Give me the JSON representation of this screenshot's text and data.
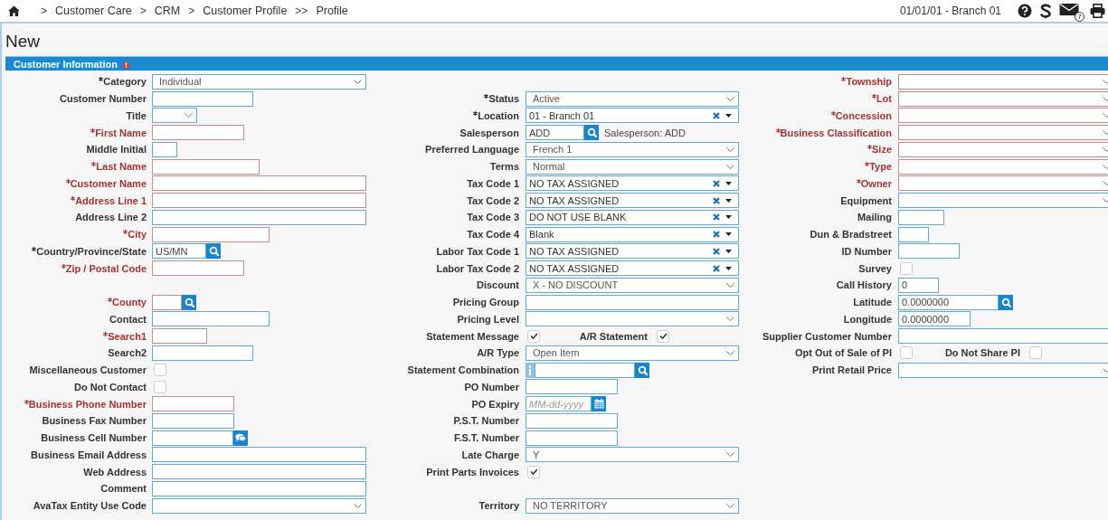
{
  "breadcrumb": [
    {
      "kind": "separator",
      "text": ">"
    },
    {
      "kind": "link",
      "text": "Customer Care"
    },
    {
      "kind": "separator",
      "text": ">"
    },
    {
      "kind": "link",
      "text": "CRM"
    },
    {
      "kind": "separator",
      "text": ">"
    },
    {
      "kind": "link",
      "text": "Customer Profile"
    },
    {
      "kind": "separator",
      "text": ">>"
    },
    {
      "kind": "current",
      "text": "Profile"
    }
  ],
  "session": "01/01/01 - Branch 01",
  "mail_count": "7",
  "page_title": "New",
  "section": {
    "title": "Customer Information",
    "warning": true
  },
  "columns": [
    {
      "groups": [
        [
          {
            "label": "Category",
            "kind": "select",
            "required": true,
            "invalid": false,
            "value": "Individual"
          },
          {
            "label": "Customer Number",
            "kind": "text",
            "required": false,
            "invalid": false
          },
          {
            "label": "Title",
            "kind": "select",
            "required": false,
            "invalid": false
          },
          {
            "label": "First Name",
            "kind": "text",
            "required": true,
            "invalid": true
          },
          {
            "label": "Middle Initial",
            "kind": "text",
            "required": false,
            "invalid": false
          },
          {
            "label": "Last Name",
            "kind": "text",
            "required": true,
            "invalid": true
          },
          {
            "label": "Customer Name",
            "kind": "text",
            "required": true,
            "invalid": true
          },
          {
            "label": "Address Line 1",
            "kind": "text",
            "required": true,
            "invalid": true
          },
          {
            "label": "Address Line 2",
            "kind": "text",
            "required": false,
            "invalid": false
          },
          {
            "label": "City",
            "kind": "text",
            "required": true,
            "invalid": true
          },
          {
            "label": "Country/Province/State",
            "kind": "lookup",
            "required": true,
            "invalid": false,
            "value": "US/MN"
          },
          {
            "label": "Zip / Postal Code",
            "kind": "text",
            "required": true,
            "invalid": true
          }
        ],
        [
          {
            "label": "County",
            "kind": "lookup",
            "required": true,
            "invalid": true
          },
          {
            "label": "Contact",
            "kind": "text",
            "required": false,
            "invalid": false
          },
          {
            "label": "Search1",
            "kind": "text",
            "required": true,
            "invalid": true
          },
          {
            "label": "Search2",
            "kind": "text",
            "required": false,
            "invalid": false
          },
          {
            "label": "Miscellaneous Customer",
            "kind": "checkbox",
            "required": false,
            "invalid": false,
            "checked": false
          },
          {
            "label": "Do Not Contact",
            "kind": "checkbox",
            "required": false,
            "invalid": false,
            "checked": false
          },
          {
            "label": "Business Phone Number",
            "kind": "text",
            "required": true,
            "invalid": true
          },
          {
            "label": "Business Fax Number",
            "kind": "text",
            "required": false,
            "invalid": false
          },
          {
            "label": "Business Cell Number",
            "kind": "chat",
            "required": false,
            "invalid": false
          },
          {
            "label": "Business Email Address",
            "kind": "text",
            "required": false,
            "invalid": false
          },
          {
            "label": "Web Address",
            "kind": "text",
            "required": false,
            "invalid": false
          },
          {
            "label": "Comment",
            "kind": "text",
            "required": false,
            "invalid": false
          },
          {
            "label": "AvaTax Entity Use Code",
            "kind": "select",
            "required": false,
            "invalid": false
          }
        ]
      ]
    },
    {
      "groups": [
        [
          {
            "label": "Status",
            "kind": "select",
            "required": true,
            "invalid": false,
            "value": "Active"
          },
          {
            "label": "Location",
            "kind": "combo",
            "required": true,
            "invalid": false,
            "value": "01 - Branch 01"
          },
          {
            "label": "Salesperson",
            "kind": "lookup",
            "required": false,
            "invalid": false,
            "value": "ADD",
            "note": "Salesperson: ADD"
          },
          {
            "label": "Preferred Language",
            "kind": "select",
            "required": false,
            "invalid": false,
            "value": "French 1"
          },
          {
            "label": "Terms",
            "kind": "select",
            "required": false,
            "invalid": false,
            "value": "Normal"
          },
          {
            "label": "Tax Code 1",
            "kind": "combo",
            "required": false,
            "invalid": false,
            "value": "NO TAX ASSIGNED"
          },
          {
            "label": "Tax Code 2",
            "kind": "combo",
            "required": false,
            "invalid": false,
            "value": "NO TAX ASSIGNED"
          },
          {
            "label": "Tax Code 3",
            "kind": "combo",
            "required": false,
            "invalid": false,
            "value": "DO NOT USE BLANK"
          },
          {
            "label": "Tax Code 4",
            "kind": "combo",
            "required": false,
            "invalid": false,
            "value": "Blank"
          },
          {
            "label": "Labor Tax Code 1",
            "kind": "combo",
            "required": false,
            "invalid": false,
            "value": "NO TAX ASSIGNED"
          },
          {
            "label": "Labor Tax Code 2",
            "kind": "combo",
            "required": false,
            "invalid": false,
            "value": "NO TAX ASSIGNED"
          },
          {
            "label": "Discount",
            "kind": "select",
            "required": false,
            "invalid": false,
            "value": "X - NO DISCOUNT"
          },
          {
            "label": "Pricing Group",
            "kind": "text",
            "required": false,
            "invalid": false
          },
          {
            "label": "Pricing Level",
            "kind": "select",
            "required": false,
            "invalid": false
          },
          {
            "label": "Statement Message",
            "kind": "checkbox",
            "required": false,
            "invalid": false,
            "checked": true,
            "second": {
              "label": "A/R Statement",
              "checked": true
            }
          },
          {
            "label": "A/R Type",
            "kind": "select",
            "required": false,
            "invalid": false,
            "value": "Open Item"
          },
          {
            "label": "Statement Combination",
            "kind": "info-lookup",
            "required": false,
            "invalid": false
          },
          {
            "label": "PO Number",
            "kind": "text",
            "required": false,
            "invalid": false
          },
          {
            "label": "PO Expiry",
            "kind": "date",
            "required": false,
            "invalid": false,
            "placeholder": "MM-dd-yyyy"
          },
          {
            "label": "P.S.T. Number",
            "kind": "text",
            "required": false,
            "invalid": false
          },
          {
            "label": "F.S.T. Number",
            "kind": "text",
            "required": false,
            "invalid": false
          },
          {
            "label": "Late Charge",
            "kind": "select",
            "required": false,
            "invalid": false,
            "value": "Y"
          },
          {
            "label": "Print Parts Invoices",
            "kind": "checkbox",
            "required": false,
            "invalid": false,
            "checked": true
          }
        ],
        [
          {
            "label": "Territory",
            "kind": "select",
            "required": false,
            "invalid": false,
            "value": "NO TERRITORY"
          }
        ]
      ]
    },
    {
      "groups": [
        [
          {
            "label": "Township",
            "kind": "select",
            "required": true,
            "invalid": true
          },
          {
            "label": "Lot",
            "kind": "select",
            "required": true,
            "invalid": true
          },
          {
            "label": "Concession",
            "kind": "select",
            "required": true,
            "invalid": true
          },
          {
            "label": "Business Classification",
            "kind": "select",
            "required": true,
            "invalid": true
          },
          {
            "label": "Size",
            "kind": "select",
            "required": true,
            "invalid": true
          },
          {
            "label": "Type",
            "kind": "select",
            "required": true,
            "invalid": true
          },
          {
            "label": "Owner",
            "kind": "select",
            "required": true,
            "invalid": true
          },
          {
            "label": "Equipment",
            "kind": "select",
            "required": false,
            "invalid": false
          },
          {
            "label": "Mailing",
            "kind": "text",
            "required": false,
            "invalid": false
          },
          {
            "label": "Dun & Bradstreet",
            "kind": "text",
            "required": false,
            "invalid": false
          },
          {
            "label": "ID Number",
            "kind": "text",
            "required": false,
            "invalid": false
          },
          {
            "label": "Survey",
            "kind": "checkbox",
            "required": false,
            "invalid": false,
            "checked": false
          },
          {
            "label": "Call History",
            "kind": "text",
            "required": false,
            "invalid": false,
            "value": "0"
          },
          {
            "label": "Latitude",
            "kind": "lookup",
            "required": false,
            "invalid": false,
            "value": "0.0000000"
          },
          {
            "label": "Longitude",
            "kind": "text",
            "required": false,
            "invalid": false,
            "value": "0.0000000"
          },
          {
            "label": "Supplier Customer Number",
            "kind": "text",
            "required": false,
            "invalid": false
          },
          {
            "label": "Opt Out of Sale of PI",
            "kind": "checkbox",
            "required": false,
            "invalid": false,
            "checked": false,
            "second": {
              "label": "Do Not Share PI",
              "checked": false
            }
          },
          {
            "label": "Print Retail Price",
            "kind": "select",
            "required": false,
            "invalid": false
          }
        ]
      ]
    }
  ]
}
